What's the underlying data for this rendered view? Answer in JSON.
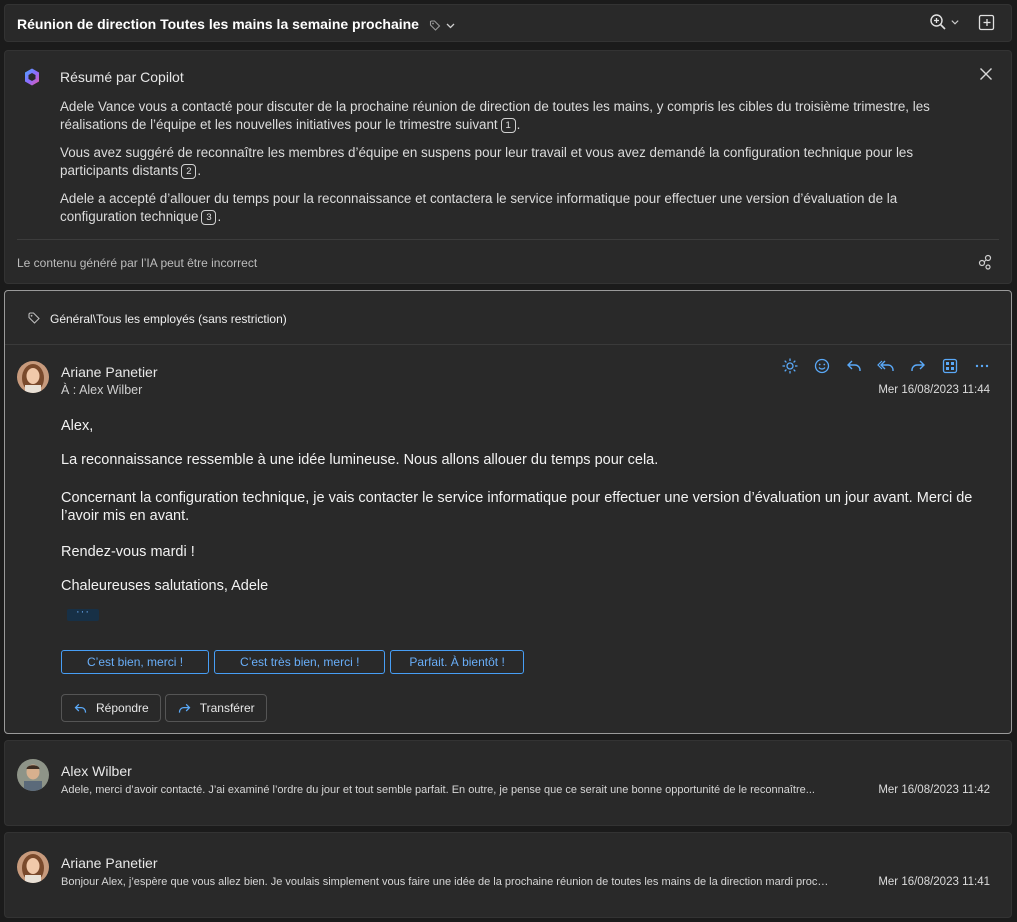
{
  "header": {
    "title": "Réunion de direction Toutes les mains la semaine prochaine",
    "icons": [
      "tag-icon",
      "chevron-down-icon",
      "zoom-icon",
      "chevron-down-icon",
      "open-window-icon"
    ]
  },
  "copilot": {
    "title": "Résumé par Copilot",
    "paragraphs": [
      {
        "text": "Adele Vance vous a contacté pour discuter de la prochaine réunion de direction de toutes les mains, y compris les cibles du troisième trimestre, les réalisations de l’équipe et les nouvelles initiatives pour le trimestre suivant",
        "cite": "1",
        "end": "."
      },
      {
        "text": "Vous avez suggéré de reconnaître les membres d’équipe en suspens pour leur travail et vous avez demandé la configuration technique pour les participants distants",
        "cite": "2",
        "end": "."
      },
      {
        "text": "Adele a accepté d’allouer du temps pour la reconnaissance et contactera le service informatique pour effectuer une version d’évaluation de la configuration technique",
        "cite": "3",
        "end": "."
      }
    ],
    "disclaimer": "Le contenu généré par l’IA peut être incorrect"
  },
  "message": {
    "category": "Général\\Tous les employés (sans restriction)",
    "sender": "Ariane Panetier",
    "to": "À : Alex Wilber",
    "date": "Mer 16/08/2023 11:44",
    "body": {
      "greeting": "Alex,",
      "line1": "La reconnaissance ressemble à une idée lumineuse. Nous allons allouer du temps pour cela.",
      "line2": "Concernant la configuration technique, je vais contacter le service informatique pour effectuer une version d’évaluation un jour avant. Merci de l’avoir mis en avant.",
      "line3": "Rendez-vous mardi !",
      "signoff": "Chaleureuses salutations, Adele"
    },
    "more": "···",
    "suggestions": [
      "C’est bien, merci !",
      "C’est très bien, merci !",
      "Parfait. À bientôt !"
    ],
    "reply_label": "Répondre",
    "forward_label": "Transférer"
  },
  "thread": [
    {
      "sender": "Alex Wilber",
      "preview": "Adele, merci d’avoir contacté. J’ai examiné l’ordre du jour et tout semble parfait. En outre, je pense que ce serait une bonne opportunité de le reconnaître...",
      "date": "Mer 16/08/2023 11:42"
    },
    {
      "sender": "Ariane Panetier",
      "preview": "Bonjour Alex, j’espère que vous allez bien. Je voulais simplement vous faire une idée de la prochaine réunion de toutes les mains de la direction mardi prochai...",
      "date": "Mer 16/08/2023 11:41"
    }
  ],
  "colors": {
    "accent": "#479ef5",
    "background": "#1b1b1b",
    "panel": "#292929"
  }
}
